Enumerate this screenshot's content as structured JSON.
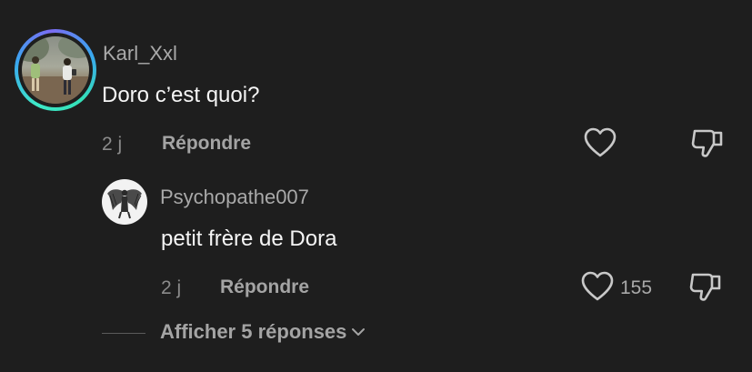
{
  "comment": {
    "username": "Karl_Xxl",
    "text": "Doro c’est quoi?",
    "age": "2 j",
    "reply_label": "Répondre",
    "like_icon": "heart-icon",
    "dislike_icon": "thumbs-down-icon"
  },
  "reply": {
    "username": "Psychopathe007",
    "text": "petit frère de Dora",
    "age": "2 j",
    "reply_label": "Répondre",
    "like_count": "155",
    "like_icon": "heart-icon",
    "dislike_icon": "thumbs-down-icon"
  },
  "thread": {
    "show_more_label": "Afficher 5 réponses",
    "chevron_icon": "chevron-down-icon"
  },
  "colors": {
    "background": "#1e1e1e",
    "ring_start": "#3ee8c8",
    "ring_mid": "#3aa6f0",
    "ring_end": "#7b6cf2"
  }
}
